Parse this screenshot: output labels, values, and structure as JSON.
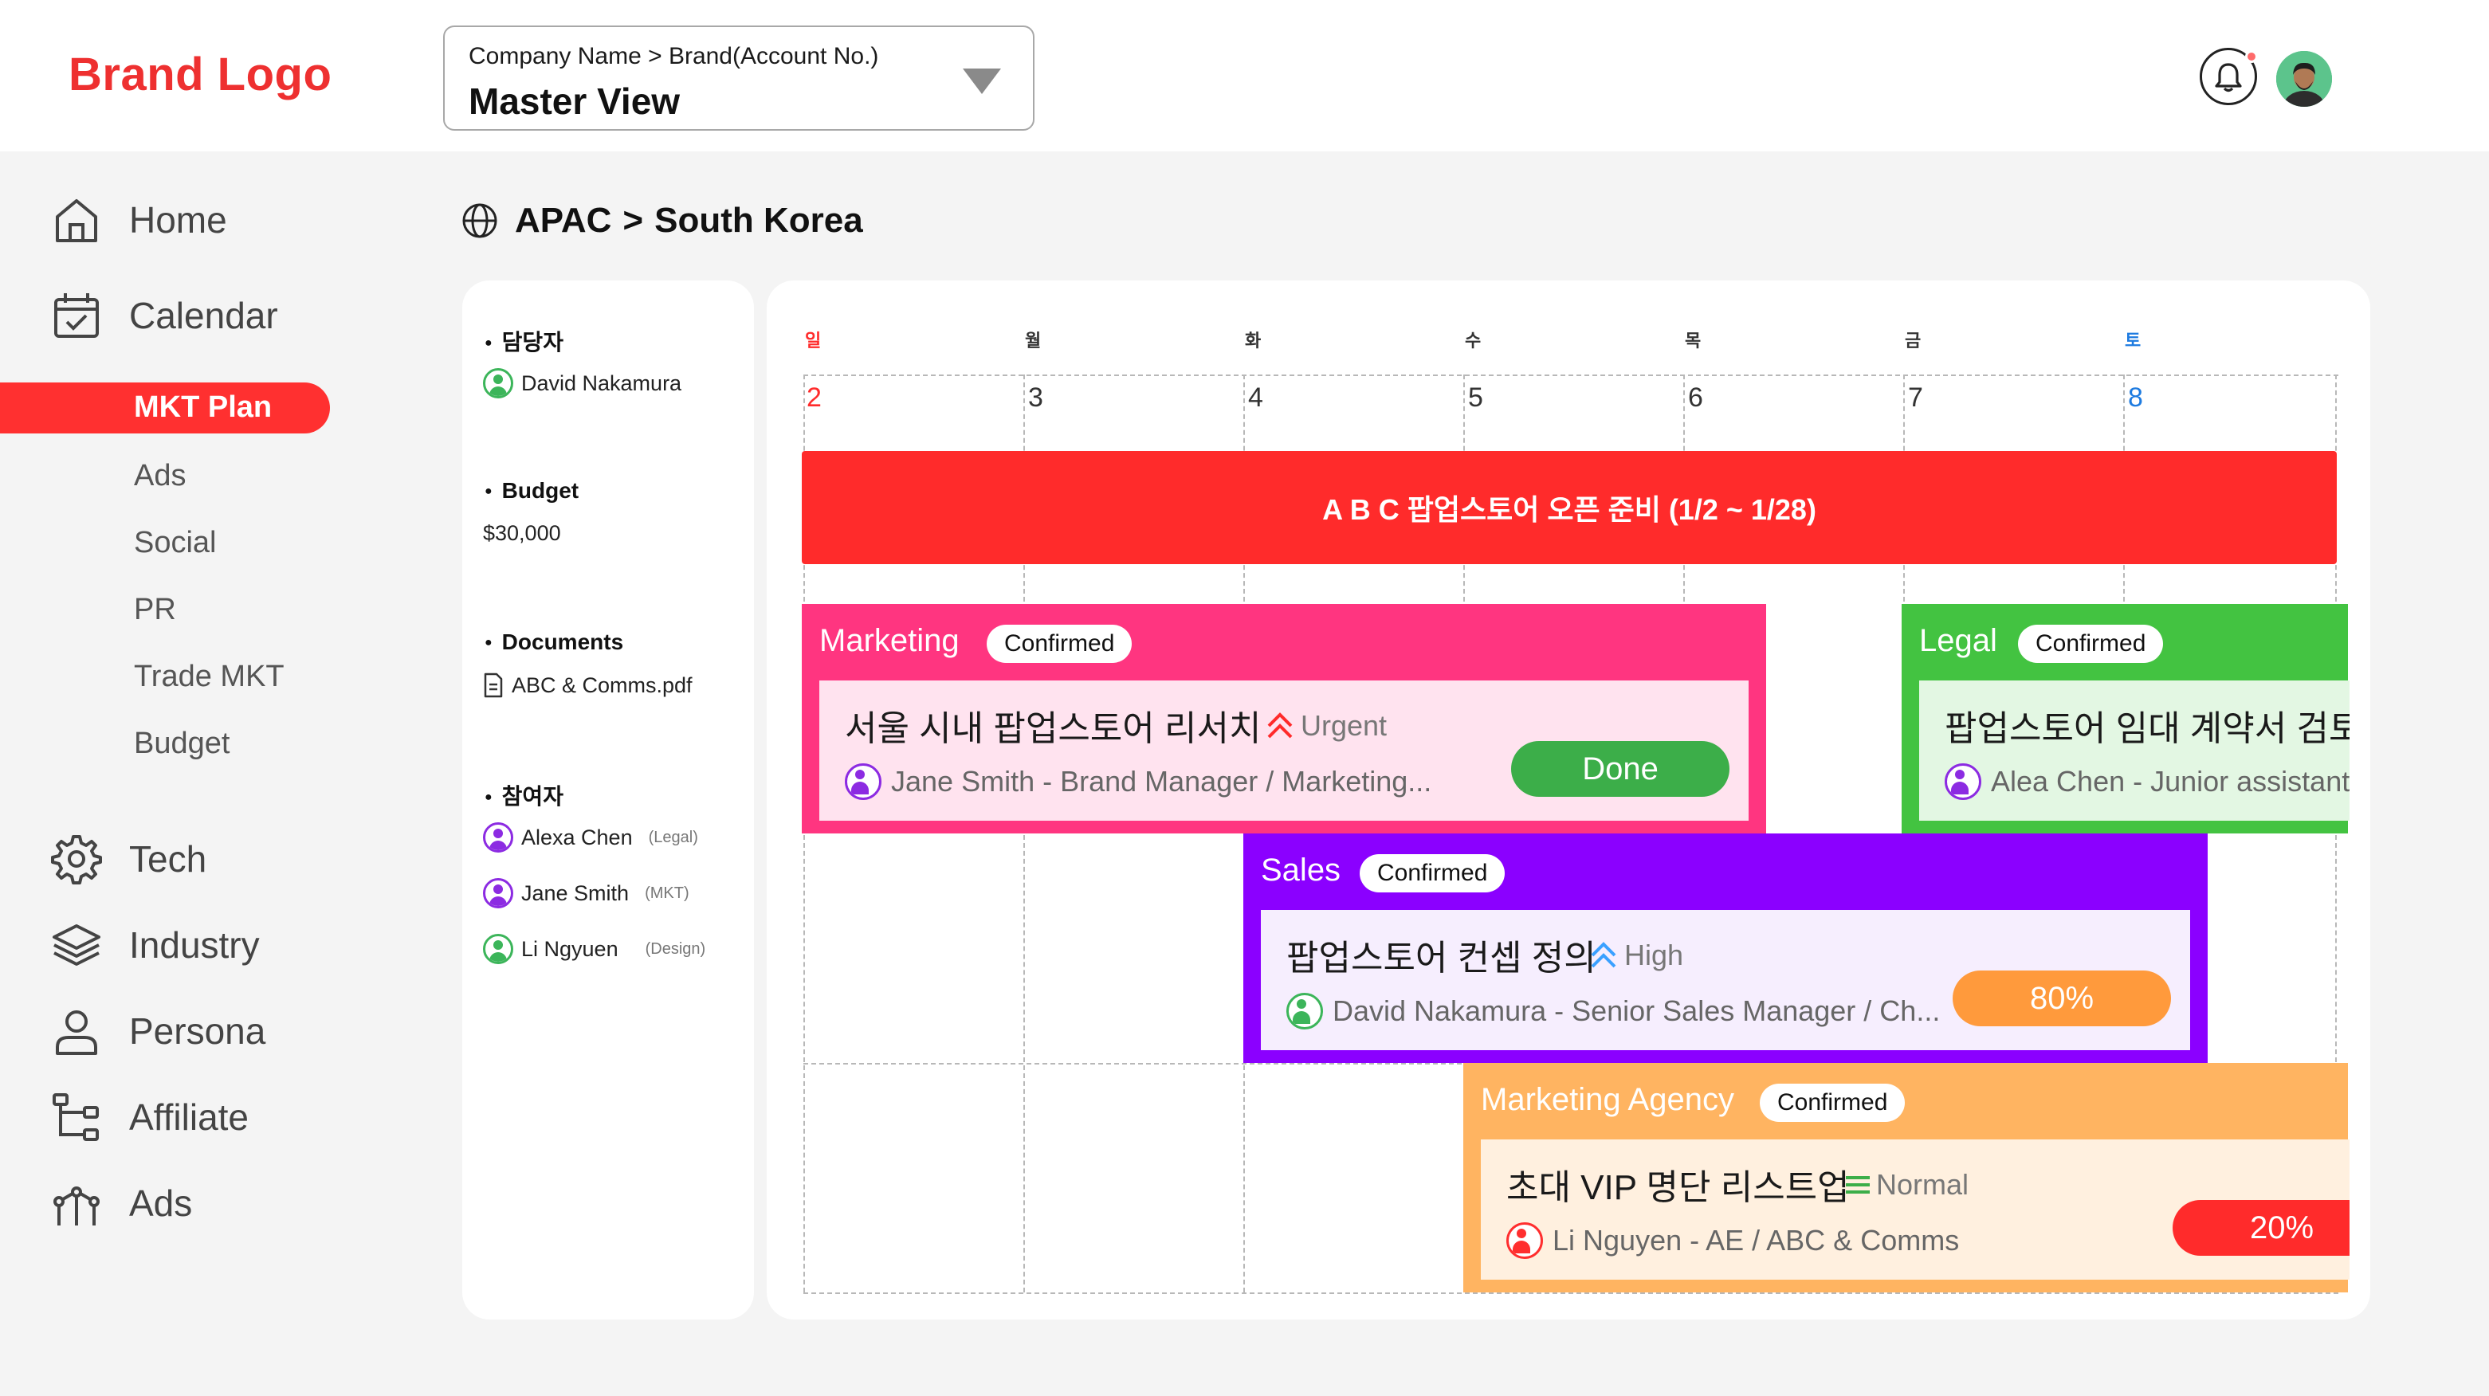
{
  "header": {
    "brand_logo": "Brand Logo",
    "account_path": "Company Name > Brand(Account No.)",
    "account_view": "Master View"
  },
  "sidebar": {
    "items": [
      {
        "label": "Home",
        "icon": "home-icon"
      },
      {
        "label": "Calendar",
        "icon": "calendar-icon"
      },
      {
        "label": "Tech",
        "icon": "gear-icon"
      },
      {
        "label": "Industry",
        "icon": "layers-icon"
      },
      {
        "label": "Persona",
        "icon": "user-icon"
      },
      {
        "label": "Affiliate",
        "icon": "hierarchy-icon"
      },
      {
        "label": "Ads",
        "icon": "ads-icon"
      }
    ],
    "calendar_subitems": [
      "MKT Plan",
      "Ads",
      "Social",
      "PR",
      "Trade MKT",
      "Budget"
    ],
    "active_subitem": "MKT Plan"
  },
  "breadcrumb": {
    "region": "APAC",
    "separator": ">",
    "country": "South Korea"
  },
  "info": {
    "owner_heading": "담당자",
    "owner": "David Nakamura",
    "budget_heading": "Budget",
    "budget": "$30,000",
    "documents_heading": "Documents",
    "document": "ABC & Comms.pdf",
    "participants_heading": "참여자",
    "participants": [
      {
        "name": "Alexa Chen",
        "tag": "(Legal)"
      },
      {
        "name": "Jane Smith",
        "tag": "(MKT)"
      },
      {
        "name": "Li Ngyuen",
        "tag": "(Design)"
      }
    ]
  },
  "calendar": {
    "weekdays": [
      "일",
      "월",
      "화",
      "수",
      "목",
      "금",
      "토"
    ],
    "dates": [
      "2",
      "3",
      "4",
      "5",
      "6",
      "7",
      "8"
    ],
    "banner": "A B C 팝업스토어 오픈 준비 (1/2 ~ 1/28)",
    "events": [
      {
        "team": "Marketing",
        "badge": "Confirmed",
        "task": "서울 시내 팝업스토어 리서치",
        "priority": "Urgent",
        "person": "Jane Smith - Brand Manager / Marketing...",
        "status": "Done"
      },
      {
        "team": "Legal",
        "badge": "Confirmed",
        "task": "팝업스토어 임대 계약서 검토",
        "person": "Alea Chen - Junior assistant"
      },
      {
        "team": "Sales",
        "badge": "Confirmed",
        "task": "팝업스토어 컨셉 정의",
        "priority": "High",
        "person": "David Nakamura - Senior Sales Manager / Ch...",
        "status": "80%"
      },
      {
        "team": "Marketing Agency",
        "badge": "Confirmed",
        "task": "초대 VIP 명단 리스트업",
        "priority": "Normal",
        "person": "Li Nguyen - AE / ABC & Comms",
        "status": "20%"
      }
    ]
  },
  "colors": {
    "brand": "#ee3030",
    "banner": "#ff2b2b",
    "marketing": "#ff3580",
    "legal": "#43c341",
    "sales": "#8b00ff",
    "agency": "#ffb461",
    "done": "#3cae49",
    "progress": "#ff9a3c"
  }
}
